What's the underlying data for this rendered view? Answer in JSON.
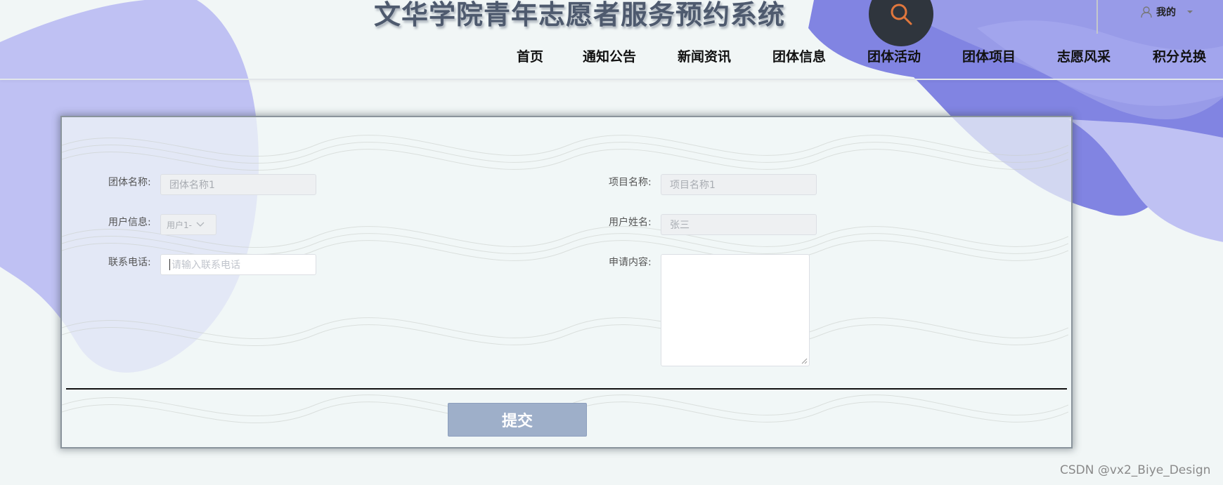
{
  "header": {
    "site_title": "文华学院青年志愿者服务预约系统",
    "search_icon": "search-icon",
    "user_menu_label": "我的",
    "user_icon": "user-icon",
    "dropdown_icon": "caret-down-icon"
  },
  "nav": {
    "items": [
      "首页",
      "通知公告",
      "新闻资讯",
      "团体信息",
      "团体活动",
      "团体项目",
      "志愿风采",
      "积分兑换"
    ]
  },
  "form": {
    "group_name": {
      "label": "团体名称:",
      "value": "团体名称1"
    },
    "project_name": {
      "label": "项目名称:",
      "value": "项目名称1"
    },
    "user_info": {
      "label": "用户信息:",
      "value": "用户1-"
    },
    "user_name": {
      "label": "用户姓名:",
      "value": "张三"
    },
    "phone": {
      "label": "联系电话:",
      "placeholder": "请输入联系电话"
    },
    "application": {
      "label": "申请内容:",
      "value": ""
    },
    "submit_label": "提交"
  },
  "watermark": "CSDN @vx2_Biye_Design",
  "colors": {
    "blob": "#bfc1f3",
    "blob_dark": "#8184e2",
    "search_bg": "#2f353d",
    "search_icon": "#e1773d",
    "submit_bg": "#9eafc9"
  }
}
